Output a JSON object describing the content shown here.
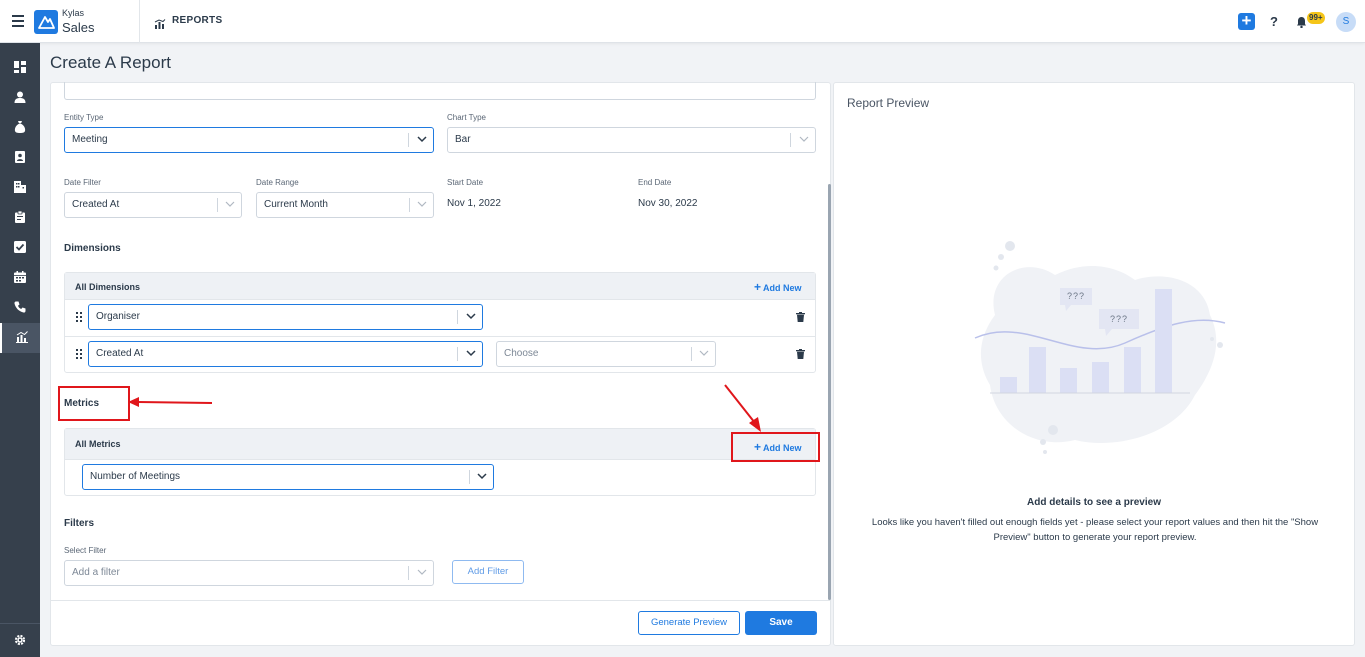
{
  "topbar": {
    "brand_top": "Kylas",
    "brand_bottom": "Sales",
    "section_label": "REPORTS",
    "notification_count": "99+",
    "avatar_initial": "S"
  },
  "page": {
    "title": "Create A Report"
  },
  "form": {
    "entity_type": {
      "label": "Entity Type",
      "value": "Meeting"
    },
    "chart_type": {
      "label": "Chart Type",
      "value": "Bar"
    },
    "date_filter": {
      "label": "Date Filter",
      "value": "Created At"
    },
    "date_range": {
      "label": "Date Range",
      "value": "Current Month"
    },
    "start_date": {
      "label": "Start Date",
      "value": "Nov 1, 2022"
    },
    "end_date": {
      "label": "End Date",
      "value": "Nov 30, 2022"
    },
    "dimensions": {
      "title": "Dimensions",
      "panel_label": "All Dimensions",
      "add_new": "Add New",
      "rows": [
        {
          "value": "Organiser"
        },
        {
          "value": "Created At",
          "secondary_placeholder": "Choose"
        }
      ]
    },
    "metrics": {
      "title": "Metrics",
      "panel_label": "All Metrics",
      "add_new": "Add New",
      "rows": [
        {
          "value": "Number of Meetings"
        }
      ]
    },
    "filters": {
      "title": "Filters",
      "select_label": "Select Filter",
      "placeholder": "Add a filter",
      "add_button": "Add Filter"
    },
    "actions": {
      "generate_preview": "Generate Preview",
      "save": "Save"
    }
  },
  "preview": {
    "title": "Report Preview",
    "empty_heading": "Add details to see a preview",
    "empty_body": "Looks like you haven't filled out enough fields yet - please select your report values and then hit the \"Show Preview\" button to generate your report preview.",
    "bubble_1": "???",
    "bubble_2": "???"
  },
  "colors": {
    "accent": "#1f7ae0",
    "sidebar": "#36404c",
    "annotation": "#e0161b"
  }
}
